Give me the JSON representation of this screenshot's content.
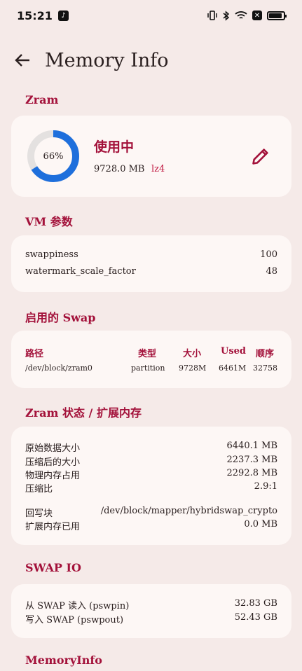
{
  "status_bar": {
    "time": "15:21",
    "tiktok_glyph": "♪",
    "battery_level": 0.9
  },
  "app_bar": {
    "title": "Memory Info"
  },
  "zram": {
    "section_title": "Zram",
    "usage_percent": 66,
    "usage_label": "66%",
    "status": "使用中",
    "size": "9728.0 MB",
    "algorithm": "lz4",
    "colors": {
      "ring_used": "#1e6fdc",
      "ring_track": "#e4e1e0"
    }
  },
  "vm": {
    "section_title": "VM 参数",
    "rows": [
      {
        "key": "swappiness",
        "value": "100"
      },
      {
        "key": "watermark_scale_factor",
        "value": "48"
      }
    ]
  },
  "swaps": {
    "section_title": "启用的 Swap",
    "headers": [
      "路径",
      "类型",
      "大小",
      "Used",
      "顺序"
    ],
    "rows": [
      [
        "/dev/block/zram0",
        "partition",
        "9728M",
        "6461M",
        "32758"
      ]
    ]
  },
  "zram_status": {
    "section_title": "Zram 状态 / 扩展内存",
    "rows": [
      {
        "key": "原始数据大小",
        "value": "6440.1 MB"
      },
      {
        "key": "压缩后的大小",
        "value": "2237.3 MB"
      },
      {
        "key": "物理内存占用",
        "value": "2292.8 MB"
      },
      {
        "key": "压缩比",
        "value": "2.9:1"
      }
    ],
    "rows2": [
      {
        "key": "回写块",
        "value": "/dev/block/mapper/hybridswap_crypto"
      },
      {
        "key": "扩展内存已用",
        "value": "0.0 MB"
      }
    ]
  },
  "swap_io": {
    "section_title": "SWAP IO",
    "rows": [
      {
        "key": "从 SWAP 读入 (pswpin)",
        "value": "32.83 GB"
      },
      {
        "key": "写入 SWAP (pswpout)",
        "value": "52.43 GB"
      }
    ]
  },
  "memory_info": {
    "section_title": "MemoryInfo"
  },
  "colors": {
    "accent": "#a3113a",
    "background": "#f5eae8",
    "card": "#fdf7f5"
  }
}
